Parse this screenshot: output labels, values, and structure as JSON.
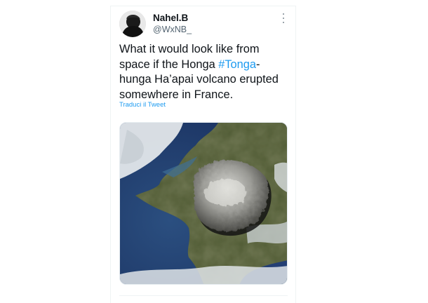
{
  "tweet": {
    "author": {
      "display_name": "Nahel.B",
      "handle": "@WxNB_",
      "avatar_icon": "user-avatar"
    },
    "more_icon": "more-vertical-icon",
    "text_before": "What it would look like from space if the Honga ",
    "hashtag": "#Tonga",
    "text_after": "-hunga Ha’apai volcano erupted somewhere in France.",
    "translate_label": "Traduci il Tweet",
    "media": {
      "kind": "satellite-image",
      "subject": "france-with-volcanic-plume"
    }
  },
  "colors": {
    "link": "#1d9bf0",
    "text": "#0f1419",
    "secondary": "#536471"
  }
}
